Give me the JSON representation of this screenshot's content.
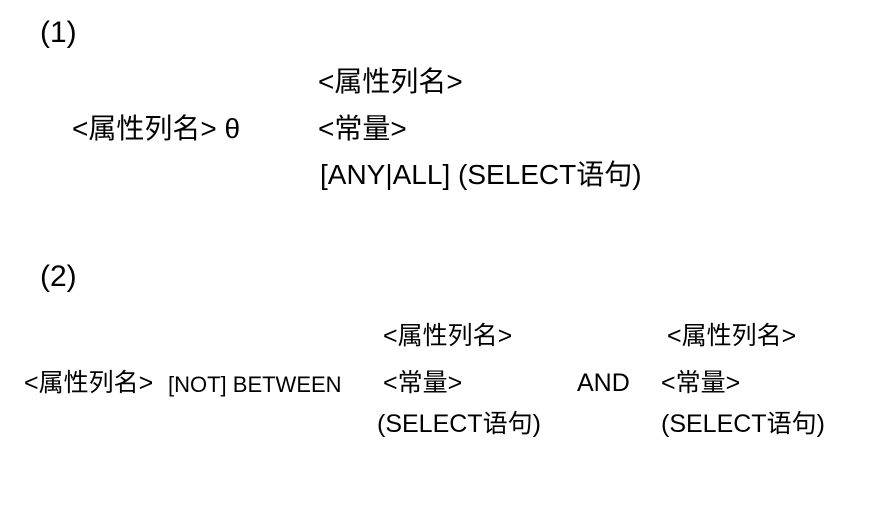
{
  "section1": {
    "marker": "(1)",
    "lhs": "<属性列名> θ",
    "options": [
      "<属性列名>",
      "<常量>",
      "[ANY|ALL]   (SELECT语句)"
    ]
  },
  "section2": {
    "marker": "(2)",
    "lhs": "<属性列名>",
    "operator": "[NOT] BETWEEN",
    "lower_options": [
      "<属性列名>",
      "<常量>",
      "(SELECT语句)"
    ],
    "conjunction": "AND",
    "upper_options": [
      "<属性列名>",
      "<常量>",
      "(SELECT语句)"
    ]
  }
}
